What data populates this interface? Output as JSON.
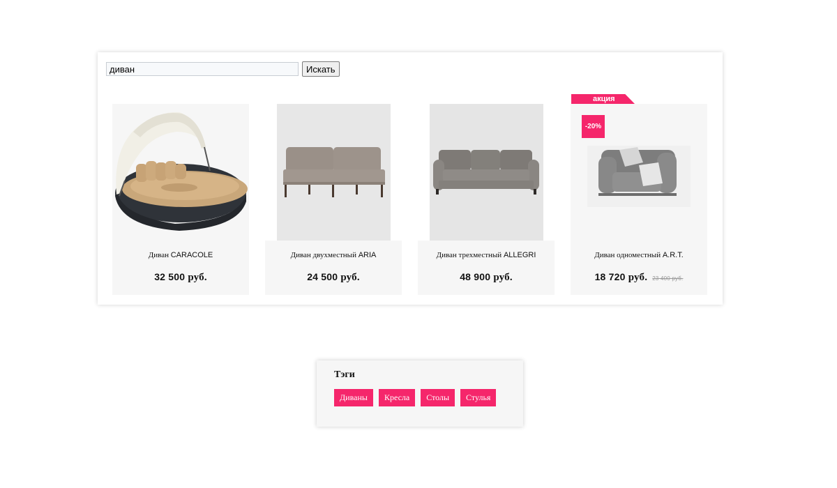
{
  "search": {
    "value": "диван",
    "button_label": "Искать"
  },
  "products": [
    {
      "name_ru": "Диван ",
      "name_latin": "CARACOLE",
      "price": "32 500",
      "currency": "руб."
    },
    {
      "name_ru": "Диван двухместный ",
      "name_latin": "ARIA",
      "price": "24 500",
      "currency": "руб."
    },
    {
      "name_ru": "Диван трехместный ",
      "name_latin": "ALLEGRI",
      "price": "48 900",
      "currency": "руб."
    },
    {
      "name_ru": "Диван одноместный ",
      "name_latin": "A.R.T.",
      "price": "18 720",
      "currency": "руб.",
      "old_price": "23 400 руб.",
      "promo_label": "акция",
      "discount": "-20%"
    }
  ],
  "tags": {
    "title": "Тэги",
    "items": [
      "Диваны",
      "Кресла",
      "Столы",
      "Стулья"
    ]
  },
  "colors": {
    "accent": "#f5266b",
    "card_bg": "#f6f6f6"
  }
}
